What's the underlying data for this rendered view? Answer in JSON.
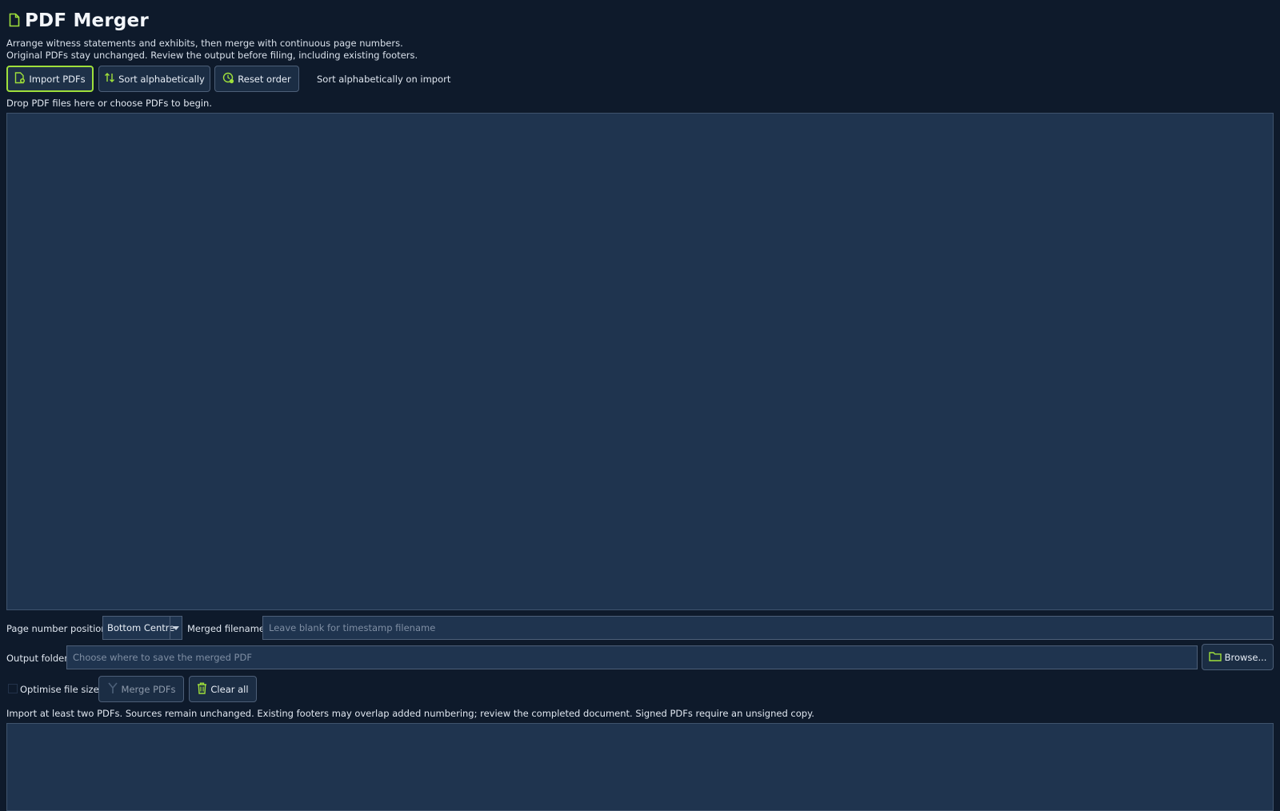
{
  "app": {
    "title": "PDF Merger",
    "subtitle_line1": "Arrange witness statements and exhibits, then merge with continuous page numbers.",
    "subtitle_line2": "Original PDFs stay unchanged. Review the output before filing, including existing footers."
  },
  "toolbar": {
    "import_label": "Import PDFs",
    "sort_label": "Sort alphabetically",
    "reset_label": "Reset order",
    "sort_on_import_label": "Sort alphabetically on import"
  },
  "drop_hint": "Drop PDF files here or choose PDFs to begin.",
  "options": {
    "page_number_position_label": "Page number position",
    "page_number_position_value": "Bottom Centre",
    "merged_filename_label": "Merged filename",
    "merged_filename_placeholder": "Leave blank for timestamp filename",
    "merged_filename_value": "",
    "output_folder_label": "Output folder",
    "output_folder_placeholder": "Choose where to save the merged PDF",
    "output_folder_value": "",
    "browse_label": "Browse..."
  },
  "actions": {
    "optimise_label": "Optimise file size",
    "optimise_checked": false,
    "merge_label": "Merge PDFs",
    "clear_label": "Clear all"
  },
  "status_text": "Import at least two PDFs. Sources remain unchanged. Existing footers may overlap added numbering; review the completed document. Signed PDFs require an unsigned copy.",
  "colors": {
    "background": "#0e1a2b",
    "panel": "#1f344f",
    "accent": "#9fe03b",
    "border": "#4d5f78"
  },
  "icons": {
    "app": "file-icon",
    "import": "file-plus-icon",
    "sort": "sort-arrows-icon",
    "reset": "clock-reset-icon",
    "dropdown": "chevron-down-icon",
    "browse": "folder-icon",
    "merge": "merge-icon",
    "clear": "trash-icon"
  }
}
